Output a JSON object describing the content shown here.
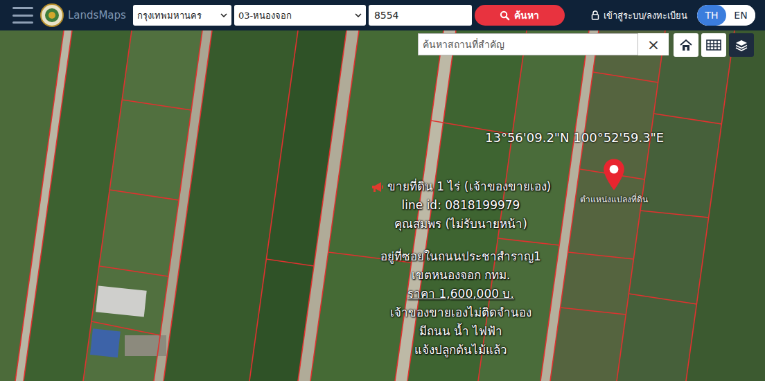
{
  "header": {
    "brand": "LandsMaps",
    "province": "กรุงเทพมหานคร",
    "district": "03-หนองจอก",
    "parcel_number": "8554",
    "search_button": "ค้นหา",
    "login": "เข้าสู่ระบบ/ลงทะเบียน",
    "languages": [
      {
        "label": "TH",
        "selected": true
      },
      {
        "label": "EN",
        "selected": false
      }
    ]
  },
  "map": {
    "search": {
      "placeholder": "ค้นหาสถานที่สำคัญ",
      "clear": "×"
    },
    "coordinates": "13°56'09.2\"N 100°52'59.3\"E",
    "pin_label": "ตำแหน่งแปลงที่ดิน",
    "ad": {
      "groups": [
        {
          "lines": [
            {
              "text": "ขายที่ดิน 1 ไร่ (เจ้าของขายเอง)",
              "underline": false
            },
            {
              "text": "line id: 0818199979",
              "underline": false
            },
            {
              "text": "คุณสมพร (ไม่รับนายหน้า)",
              "underline": false
            }
          ]
        },
        {
          "lines": [
            {
              "text": "อยู่ที่ซอยในถนนประชาสำราญ1",
              "underline": false
            },
            {
              "text": "เขตหนองจอก กทม.",
              "underline": false
            },
            {
              "text": "ราคา 1,600,000 บ.",
              "underline": true
            },
            {
              "text": "เจ้าของขายเองไม่ติดจำนอง",
              "underline": false
            },
            {
              "text": "มีถนน น้ำ ไฟฟ้า",
              "underline": false
            },
            {
              "text": "แจ้งปลูกต้นไม้แล้ว",
              "underline": false
            }
          ]
        }
      ]
    }
  }
}
